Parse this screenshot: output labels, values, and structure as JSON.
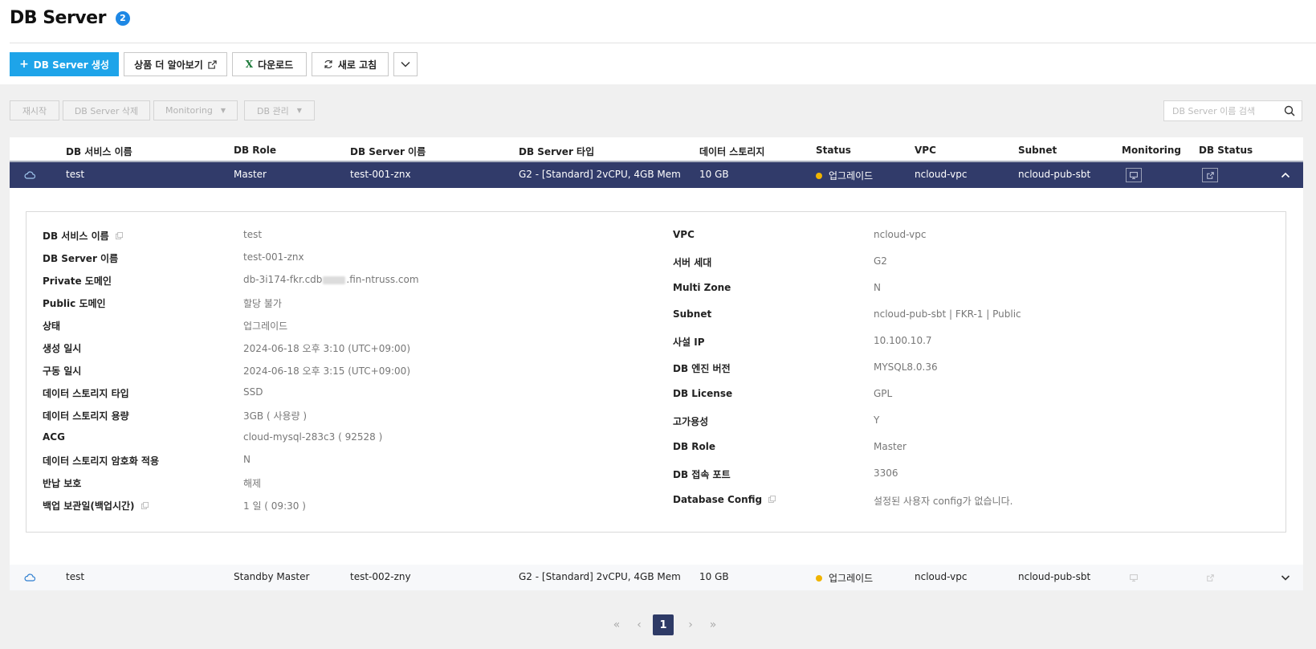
{
  "header": {
    "title": "DB Server",
    "count": "2"
  },
  "toolbar": {
    "create_label": "DB Server 생성",
    "learn_more_label": "상품 더 알아보기",
    "download_label": "다운로드",
    "refresh_label": "새로 고침"
  },
  "actions": {
    "restart": "재시작",
    "delete": "DB Server 삭제",
    "monitoring": "Monitoring",
    "db_manage": "DB 관리"
  },
  "search": {
    "placeholder": "DB Server 이름 검색"
  },
  "table": {
    "columns": [
      "DB 서비스 이름",
      "DB Role",
      "DB Server 이름",
      "DB Server 타입",
      "데이터 스토리지",
      "Status",
      "VPC",
      "Subnet",
      "Monitoring",
      "DB Status"
    ],
    "rows": [
      {
        "service": "test",
        "role": "Master",
        "server": "test-001-znx",
        "type": "G2 - [Standard] 2vCPU, 4GB Mem",
        "storage": "10 GB",
        "status": "업그레이드",
        "vpc": "ncloud-vpc",
        "subnet": "ncloud-pub-sbt"
      },
      {
        "service": "test",
        "role": "Standby Master",
        "server": "test-002-zny",
        "type": "G2 - [Standard] 2vCPU, 4GB Mem",
        "storage": "10 GB",
        "status": "업그레이드",
        "vpc": "ncloud-vpc",
        "subnet": "ncloud-pub-sbt"
      }
    ]
  },
  "detail": {
    "left": [
      {
        "label": "DB 서비스 이름",
        "value": "test"
      },
      {
        "label": "DB Server 이름",
        "value": "test-001-znx"
      },
      {
        "label": "Private 도메인",
        "value_prefix": "db-3i174-fkr.cdb",
        "value_suffix": ".fin-ntruss.com"
      },
      {
        "label": "Public 도메인",
        "value": "할당 불가"
      },
      {
        "label": "상태",
        "value": "업그레이드"
      },
      {
        "label": "생성 일시",
        "value": "2024-06-18 오후 3:10 (UTC+09:00)"
      },
      {
        "label": "구동 일시",
        "value": "2024-06-18 오후 3:15 (UTC+09:00)"
      },
      {
        "label": "데이터 스토리지 타입",
        "value": "SSD"
      },
      {
        "label": "데이터 스토리지 용량",
        "value": "3GB ( 사용량 )"
      },
      {
        "label": "ACG",
        "value": "cloud-mysql-283c3 ( 92528 )"
      },
      {
        "label": "데이터 스토리지 암호화 적용",
        "value": "N"
      },
      {
        "label": "반납 보호",
        "value": "해제"
      },
      {
        "label": "백업 보관일(백업시간)",
        "value": "1 일 ( 09:30 )"
      }
    ],
    "right": [
      {
        "label": "VPC",
        "value": "ncloud-vpc"
      },
      {
        "label": "서버 세대",
        "value": "G2"
      },
      {
        "label": "Multi Zone",
        "value": "N"
      },
      {
        "label": "Subnet",
        "value": "ncloud-pub-sbt | FKR-1 | Public"
      },
      {
        "label": "사설 IP",
        "value": "10.100.10.7"
      },
      {
        "label": "DB 엔진 버전",
        "value": "MYSQL8.0.36"
      },
      {
        "label": "DB License",
        "value": "GPL"
      },
      {
        "label": "고가용성",
        "value": "Y"
      },
      {
        "label": "DB Role",
        "value": "Master"
      },
      {
        "label": "DB 접속 포트",
        "value": "3306"
      },
      {
        "label": "Database Config",
        "value": "설정된 사용자 config가 없습니다."
      }
    ]
  },
  "pagination": {
    "first": "«",
    "prev": "‹",
    "current": "1",
    "next": "›",
    "last": "»"
  },
  "colors": {
    "primary": "#1ea4e9",
    "selected_row": "#313b6a",
    "status_dot": "#f0b400",
    "badge": "#1e88e5"
  }
}
